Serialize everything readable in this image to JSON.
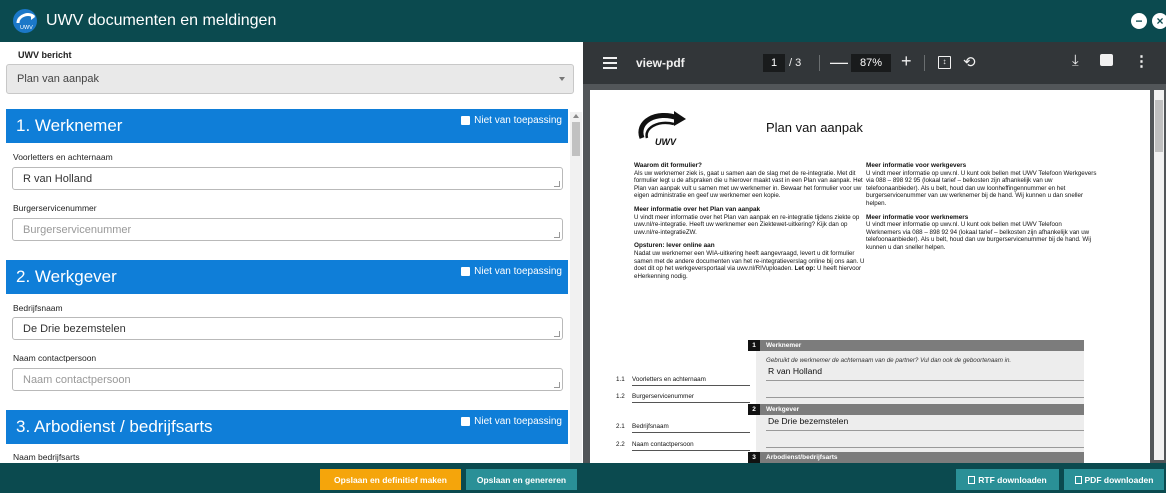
{
  "app": {
    "title": "UWV documenten en meldingen",
    "logo_text": "UWV"
  },
  "form": {
    "message_label": "UWV bericht",
    "message_value": "Plan van aanpak",
    "not_applicable": "Niet van toepassing",
    "sections": [
      {
        "title": "1. Werknemer",
        "fields": [
          {
            "label": "Voorletters en achternaam",
            "value": "R van Holland",
            "placeholder": ""
          },
          {
            "label": "Burgerservicenummer",
            "value": "",
            "placeholder": "Burgerservicenummer"
          }
        ]
      },
      {
        "title": "2. Werkgever",
        "fields": [
          {
            "label": "Bedrijfsnaam",
            "value": "De Drie bezemstelen",
            "placeholder": ""
          },
          {
            "label": "Naam contactpersoon",
            "value": "",
            "placeholder": "Naam contactpersoon"
          }
        ]
      },
      {
        "title": "3. Arbodienst / bedrijfsarts",
        "fields": [
          {
            "label": "Naam bedrijfsarts",
            "value": "",
            "placeholder": ""
          }
        ]
      }
    ]
  },
  "viewer": {
    "file_name": "view-pdf",
    "current_page": "1",
    "total_pages": "/ 3",
    "zoom": "87%",
    "icons": [
      "menu-icon",
      "zoom-out-icon",
      "zoom-in-icon",
      "fit-page-icon",
      "rotate-icon",
      "download-icon",
      "print-icon",
      "more-icon"
    ]
  },
  "pdf": {
    "title": "Plan van aanpak",
    "left_col": [
      {
        "heading": "Waarom dit formulier?",
        "text": "Als uw werknemer ziek is, gaat u samen aan de slag met de re-integratie. Met dit formulier legt u de afspraken die u hierover maakt vast in een Plan van aanpak. Het Plan van aanpak vult u samen met uw werknemer in. Bewaar het formulier voor uw eigen administratie en geef uw werknemer een kopie."
      },
      {
        "heading": "Meer informatie over het Plan van aanpak",
        "text": "U vindt meer informatie over het Plan van aanpak en re-integratie tijdens ziekte op uwv.nl/re-integratie. Heeft uw werknemer een Ziektewet-uitkering? Kijk dan op uwv.nl/re-integratieZW."
      },
      {
        "heading": "Opsturen: lever online aan",
        "text": "Nadat uw werknemer een WIA-uitkering heeft aangevraagd, levert u dit formulier samen met de andere documenten van het re-integratieverslag online bij ons aan. U doet dit op het werkgeversportaal via uwv.nl/RIVuploaden.",
        "bold_tail": "Let op:",
        "tail": "U heeft hiervoor eHerkenning nodig."
      }
    ],
    "right_col": [
      {
        "heading": "Meer informatie voor werkgevers",
        "text": "U vindt meer informatie op uwv.nl. U kunt ook bellen met UWV Telefoon Werkgevers via 088 – 898 92 95 (lokaal tarief – belkosten zijn afhankelijk van uw telefoonaanbieder). Als u belt, houd dan uw loonheffingennummer en het burgerservicenummer van uw werknemer bij de hand. Wij kunnen u dan sneller helpen."
      },
      {
        "heading": "Meer informatie voor werknemers",
        "text": "U vindt meer informatie op uwv.nl. U kunt ook bellen met UWV Telefoon Werknemers via 088 – 898 92 94 (lokaal tarief – belkosten zijn afhankelijk van uw telefoonaanbieder). Als u belt, houd dan uw burgerservicenummer bij de hand. Wij kunnen u dan sneller helpen."
      }
    ],
    "form_sections": [
      {
        "num": "1",
        "title": "Werknemer"
      },
      {
        "num": "2",
        "title": "Werkgever"
      },
      {
        "num": "3",
        "title": "Arbodienst/bedrijfsarts"
      }
    ],
    "hint": "Gebruikt de werknemer de achternaam van de partner? Vul dan ook de geboortenaam in.",
    "rows": [
      {
        "num": "1.1",
        "label": "Voorletters en achternaam",
        "value": "R van Holland"
      },
      {
        "num": "1.2",
        "label": "Burgerservicenummer",
        "value": ""
      },
      {
        "num": "2.1",
        "label": "Bedrijfsnaam",
        "value": "De Drie bezemstelen"
      },
      {
        "num": "2.2",
        "label": "Naam contactpersoon",
        "value": ""
      }
    ]
  },
  "footer": {
    "save_final": "Opslaan en definitief maken",
    "save_generate": "Opslaan en genereren",
    "rtf_download": "RTF downloaden",
    "pdf_download": "PDF downloaden"
  },
  "colors": {
    "header": "#0b4a4f",
    "section": "#0f7ed8",
    "orange": "#f5a50b",
    "teal": "#2a9097"
  }
}
